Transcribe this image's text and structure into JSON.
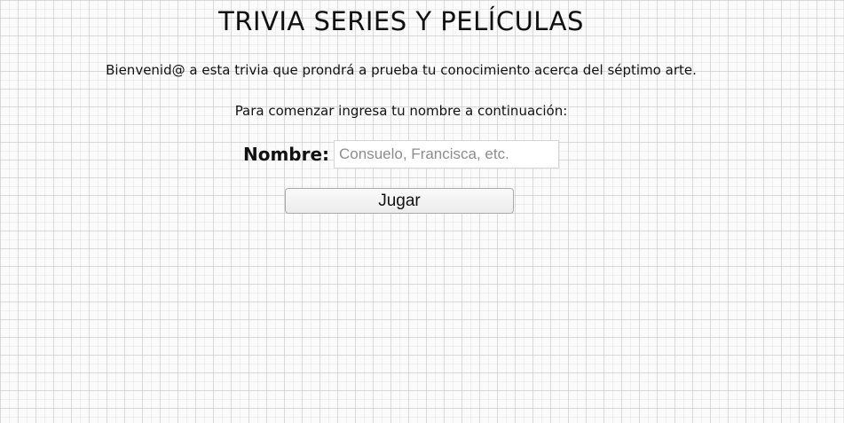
{
  "page": {
    "title": "TRIVIA SERIES Y PELÍCULAS",
    "welcome_text": "Bienvenid@ a esta trivia que prondrá a prueba tu conocimiento acerca del séptimo arte.",
    "instructions_text": "Para comenzar ingresa tu nombre a continuación:"
  },
  "form": {
    "name_label": "Nombre:",
    "name_value": "",
    "name_placeholder": "Consuelo, Francisca, etc.",
    "play_button_label": "Jugar"
  }
}
